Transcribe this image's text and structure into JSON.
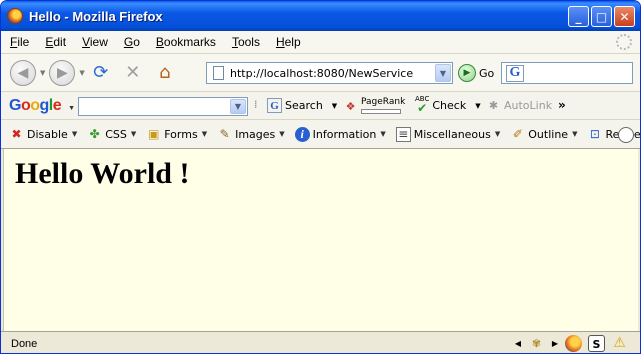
{
  "window": {
    "title": "Hello - Mozilla Firefox",
    "buttons": {
      "minimize": "_",
      "maximize": "□",
      "close": "✕"
    }
  },
  "menubar": {
    "items": [
      {
        "underline": "F",
        "rest": "ile"
      },
      {
        "underline": "E",
        "rest": "dit"
      },
      {
        "underline": "V",
        "rest": "iew"
      },
      {
        "underline": "G",
        "rest": "o"
      },
      {
        "underline": "B",
        "rest": "ookmarks"
      },
      {
        "underline": "T",
        "rest": "ools"
      },
      {
        "underline": "H",
        "rest": "elp"
      }
    ]
  },
  "navbar": {
    "back_icon": "◀",
    "forward_icon": "▶",
    "reload_icon": "⟳",
    "stop_icon": "✕",
    "home_icon": "⌂",
    "url": "http://localhost:8080/NewService",
    "go_label": "Go",
    "go_icon": "▶",
    "search_engine_letter": "G"
  },
  "googlebar": {
    "logo": [
      "G",
      "o",
      "o",
      "g",
      "l",
      "e"
    ],
    "search_label": "Search",
    "pagerank_label": "PageRank",
    "check_label": "Check",
    "check_prefix": "ABC",
    "autolink_label": "AutoLink",
    "more": "»"
  },
  "devbar": {
    "items": [
      {
        "label": "Disable",
        "icon": "✖",
        "icon_name": "disable-icon",
        "color": "#d0281c"
      },
      {
        "label": "CSS",
        "icon": "✤",
        "icon_name": "css-icon",
        "color": "#3c9a2e"
      },
      {
        "label": "Forms",
        "icon": "▣",
        "icon_name": "forms-icon",
        "color": "#c89a1a"
      },
      {
        "label": "Images",
        "icon": "✎",
        "icon_name": "images-icon",
        "color": "#8a6a2a"
      },
      {
        "label": "Information",
        "icon": "i",
        "icon_name": "information-icon",
        "color": "#2a5fd0"
      },
      {
        "label": "Miscellaneous",
        "icon": "≡",
        "icon_name": "miscellaneous-icon",
        "color": "#444444"
      },
      {
        "label": "Outline",
        "icon": "✐",
        "icon_name": "outline-icon",
        "color": "#b07d1a"
      },
      {
        "label": "Resize",
        "icon": "⊡",
        "icon_name": "resize-icon",
        "color": "#2a5fd0"
      }
    ]
  },
  "content": {
    "heading": "Hello World !"
  },
  "status": {
    "text": "Done"
  }
}
